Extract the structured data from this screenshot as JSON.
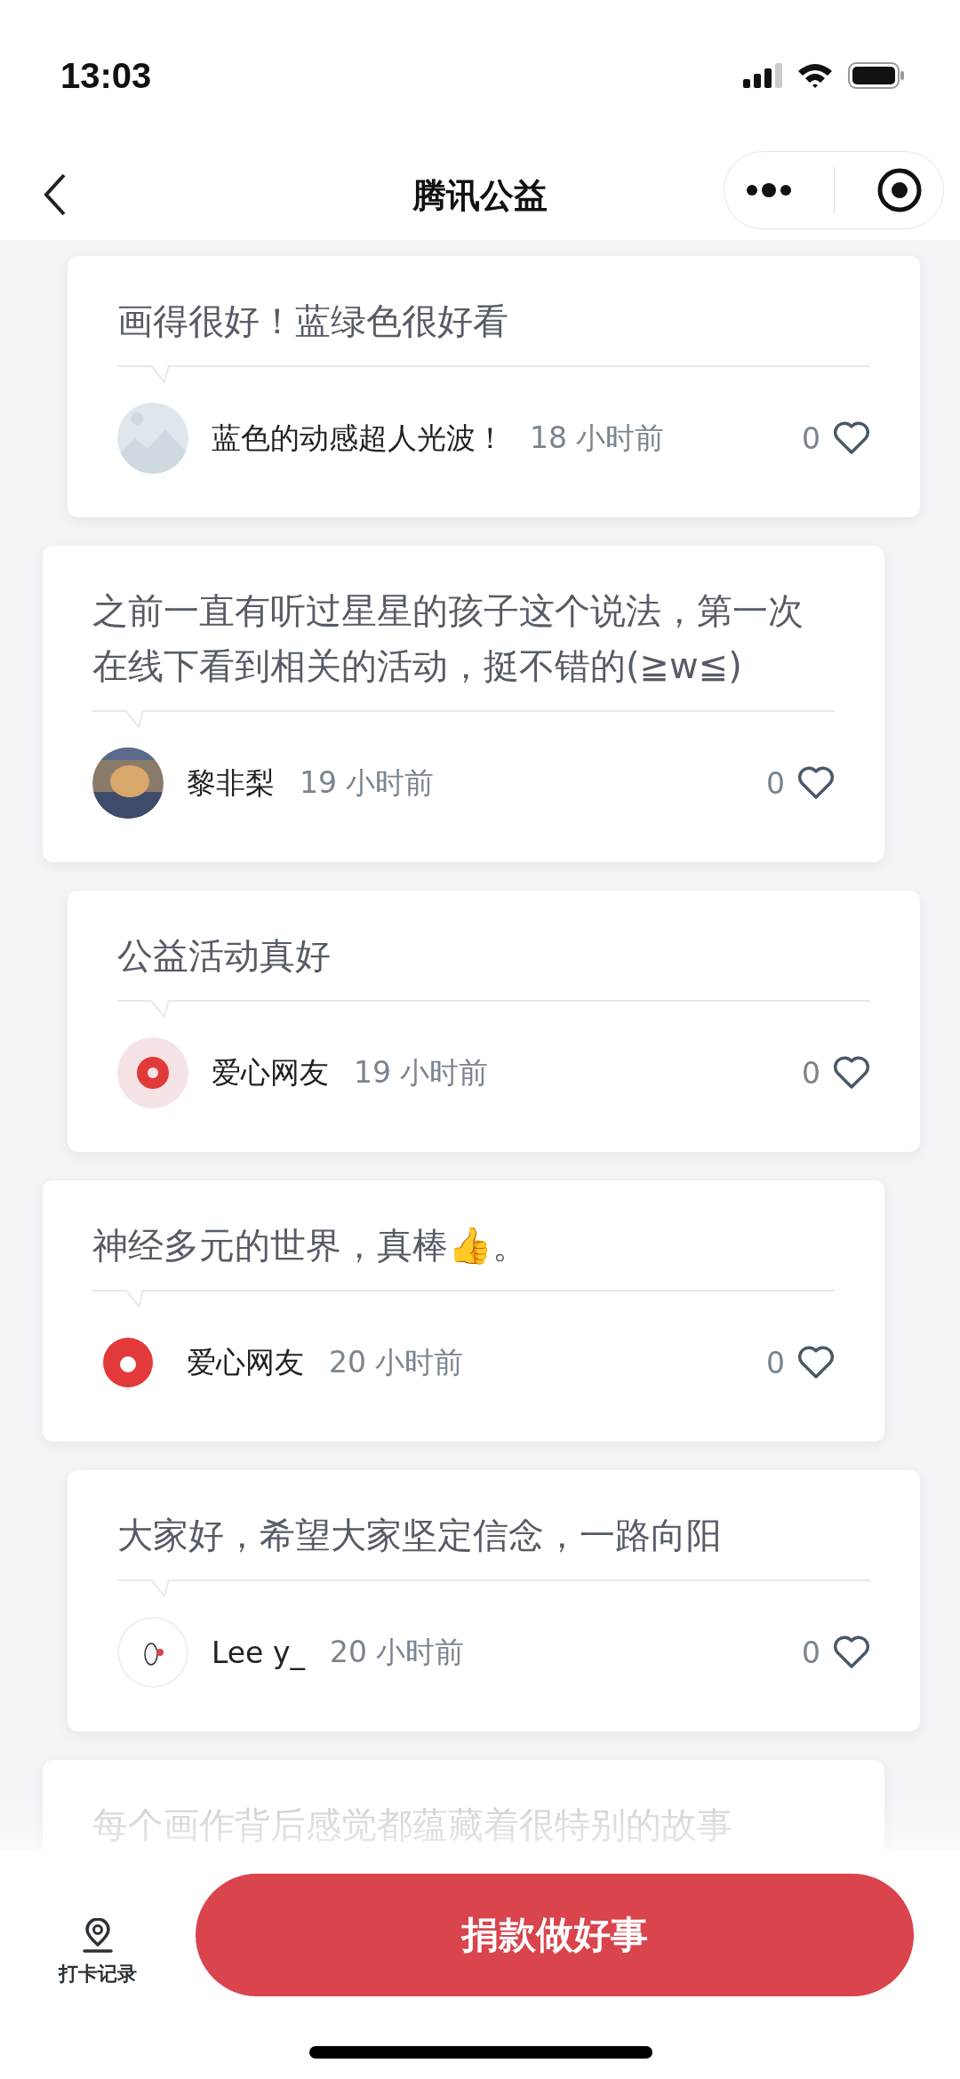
{
  "status_bar": {
    "time": "13:03"
  },
  "nav": {
    "title": "腾讯公益"
  },
  "comments": [
    {
      "text": "画得很好！蓝绿色很好看",
      "author": "蓝色的动感超人光波！",
      "time": "18 小时前",
      "likes": "0",
      "liked": false
    },
    {
      "text": "之前一直有听过星星的孩子这个说法，第一次在线下看到相关的活动，挺不错的(≧w≦)",
      "author": "黎非梨",
      "time": "19 小时前",
      "likes": "0",
      "liked": false
    },
    {
      "text": "公益活动真好",
      "author": "爱心网友",
      "time": "19 小时前",
      "likes": "0",
      "liked": false
    },
    {
      "text": "神经多元的世界，真棒👍。",
      "author": "爱心网友",
      "time": "20 小时前",
      "likes": "0",
      "liked": false
    },
    {
      "text": "大家好，希望大家坚定信念，一路向阳",
      "author": "Lee y_",
      "time": "20 小时前",
      "likes": "0",
      "liked": false
    }
  ],
  "partial_comment": {
    "text": "每个画作背后感觉都蕴藏着很特别的故事"
  },
  "bottom_bar": {
    "checkin_label": "打卡记录",
    "donate_button": "捐款做好事"
  }
}
